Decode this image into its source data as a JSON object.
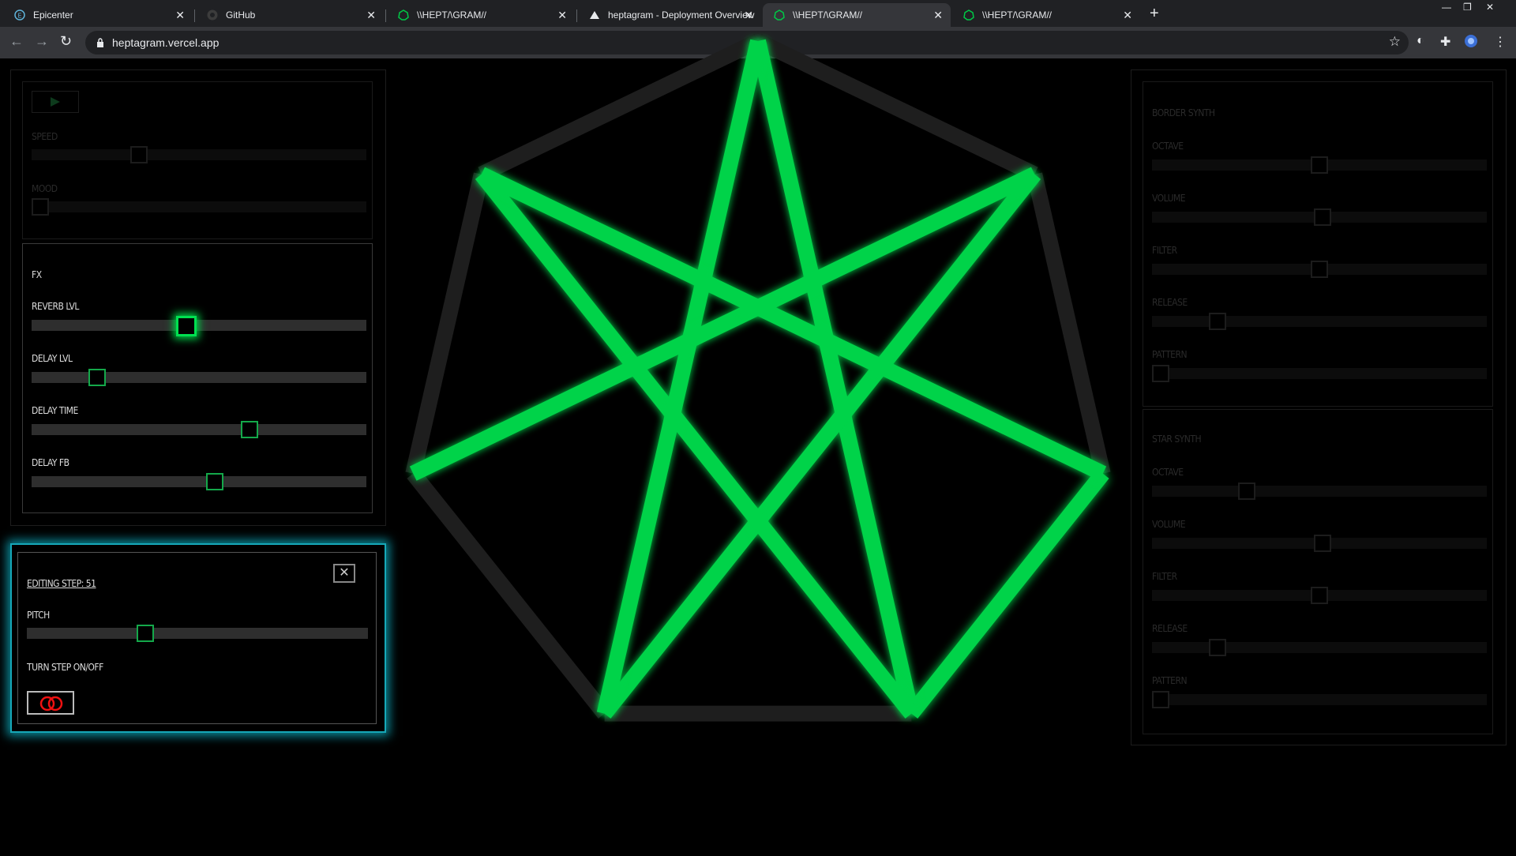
{
  "browser": {
    "tabs": [
      {
        "title": "Epicenter",
        "icon": "epicenter-favicon"
      },
      {
        "title": "GitHub",
        "icon": "github-favicon"
      },
      {
        "title": "\\\\HEPT/\\GRAM//",
        "icon": "heptagram-favicon"
      },
      {
        "title": "heptagram - Deployment Overview",
        "icon": "vercel-favicon"
      },
      {
        "title": "\\\\HEPT/\\GRAM//",
        "icon": "heptagram-favicon",
        "active": true
      },
      {
        "title": "\\\\HEPT/\\GRAM//",
        "icon": "heptagram-favicon"
      }
    ],
    "url": "heptagram.vercel.app"
  },
  "transport": {
    "play_icon": "play-icon",
    "speed_label": "SPEED",
    "speed_value": 0.31,
    "mood_label": "MOOD",
    "mood_value": 0.0
  },
  "fx": {
    "title": "FX",
    "controls": [
      {
        "label": "REVERB LVL",
        "value": 0.46
      },
      {
        "label": "DELAY LVL",
        "value": 0.18
      },
      {
        "label": "DELAY TIME",
        "value": 0.66
      },
      {
        "label": "DELAY FB",
        "value": 0.55
      }
    ]
  },
  "editor": {
    "title": "EDITING STEP: 51",
    "pitch_label": "PITCH",
    "pitch_value": 0.34,
    "toggle_label": "TURN STEP ON/OFF",
    "toggle_state": "off",
    "close_icon": "close-icon"
  },
  "border_synth": {
    "title": "BORDER SYNTH",
    "controls": [
      {
        "label": "OCTAVE",
        "value": 0.5
      },
      {
        "label": "VOLUME",
        "value": 0.51
      },
      {
        "label": "FILTER",
        "value": 0.5
      },
      {
        "label": "RELEASE",
        "value": 0.18
      },
      {
        "label": "PATTERN",
        "value": 0.0
      }
    ]
  },
  "star_synth": {
    "title": "STAR SYNTH",
    "controls": [
      {
        "label": "OCTAVE",
        "value": 0.27
      },
      {
        "label": "VOLUME",
        "value": 0.51
      },
      {
        "label": "FILTER",
        "value": 0.5
      },
      {
        "label": "RELEASE",
        "value": 0.18
      },
      {
        "label": "PATTERN",
        "value": 0.0
      }
    ]
  },
  "visual": {
    "border_color": "#1e1e1e",
    "star_color": "#00d34a",
    "border_active": [
      false,
      false,
      false,
      false,
      false,
      false,
      true
    ],
    "star_active": [
      true,
      true,
      true,
      true,
      true,
      true,
      true
    ]
  }
}
